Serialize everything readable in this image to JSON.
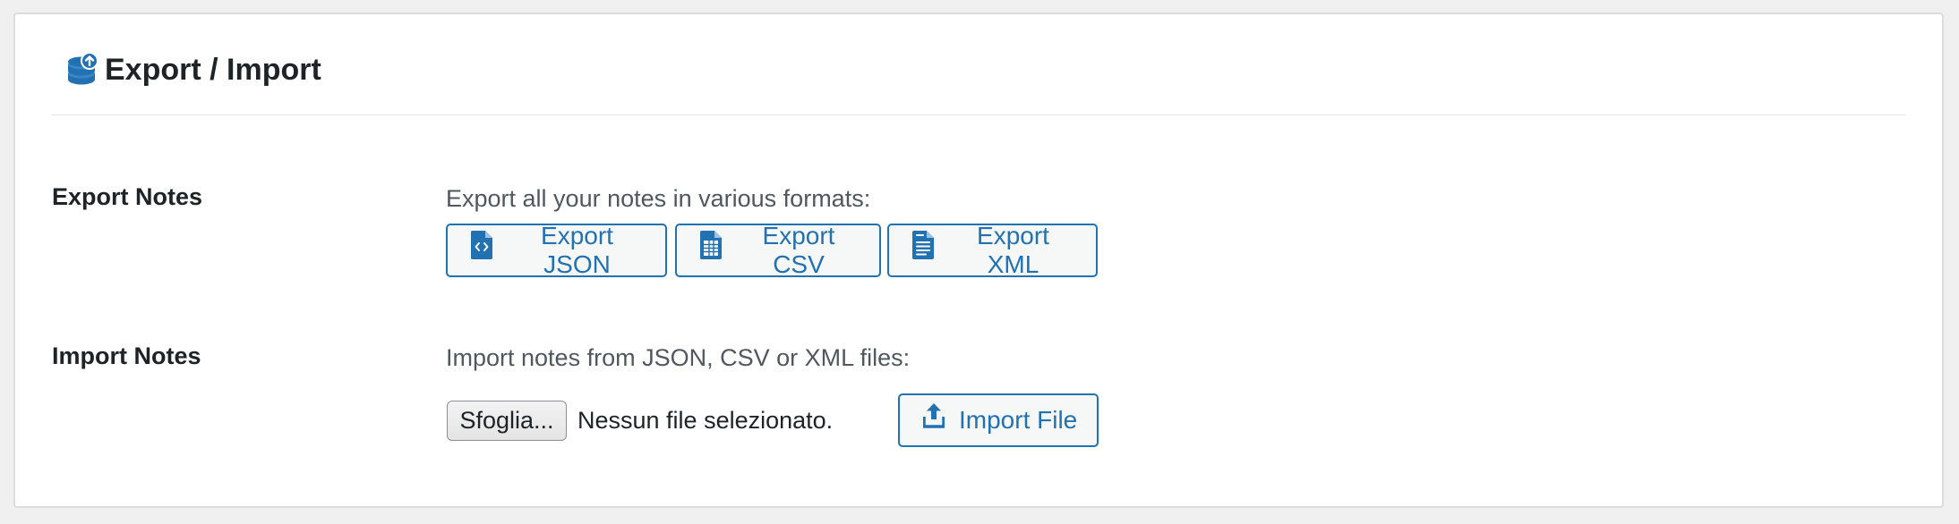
{
  "header": {
    "title": "Export / Import",
    "icon": "database-upload-icon"
  },
  "export": {
    "label": "Export Notes",
    "description": "Export all your notes in various formats:",
    "buttons": [
      {
        "label": "Export JSON",
        "icon": "file-code-icon"
      },
      {
        "label": "Export CSV",
        "icon": "spreadsheet-icon"
      },
      {
        "label": "Export XML",
        "icon": "document-icon"
      }
    ]
  },
  "import": {
    "label": "Import Notes",
    "description": "Import notes from JSON, CSV or XML files:",
    "file_button_label": "Sfoglia...",
    "file_status": "Nessun file selezionato.",
    "import_button_label": "Import File",
    "import_icon": "upload-icon"
  },
  "colors": {
    "accent": "#2271b1",
    "text": "#1d2327",
    "muted_text": "#50575e",
    "border": "#dcdcde",
    "background": "#f0f0f1"
  }
}
